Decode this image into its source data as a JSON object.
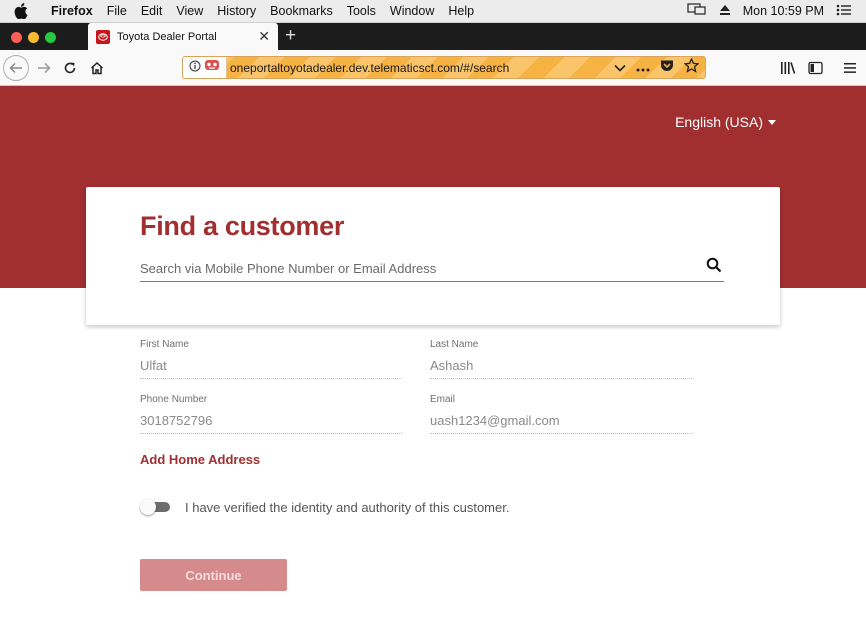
{
  "menubar": {
    "app_name": "Firefox",
    "items": [
      "File",
      "Edit",
      "View",
      "History",
      "Bookmarks",
      "Tools",
      "Window",
      "Help"
    ],
    "clock": "Mon 10:59 PM"
  },
  "browser": {
    "tab_title": "Toyota Dealer Portal",
    "url": "oneportaltoyotadealer.dev.telematicsct.com/#/search"
  },
  "page": {
    "language": "English (USA)",
    "card_title": "Find a customer",
    "search_placeholder": "Search via Mobile Phone Number or Email Address",
    "fields": {
      "first_name": {
        "label": "First Name",
        "value": "Ulfat"
      },
      "last_name": {
        "label": "Last Name",
        "value": "Ashash"
      },
      "phone": {
        "label": "Phone Number",
        "value": "3018752796"
      },
      "email": {
        "label": "Email",
        "value": "uash1234@gmail.com"
      }
    },
    "add_address_label": "Add Home Address",
    "verify_text": "I have verified the identity and authority of this customer.",
    "verify_checked": false,
    "continue_label": "Continue"
  },
  "colors": {
    "brand_red": "#a12f30",
    "button_disabled": "#d58a8c",
    "url_bar_orange": "#f7b244"
  },
  "icons": [
    "apple-icon",
    "screen-mirror-icon",
    "eject-icon",
    "notification-list-icon",
    "toyota-favicon",
    "close-icon",
    "plus-icon",
    "back-arrow-icon",
    "forward-arrow-icon",
    "reload-icon",
    "home-icon",
    "info-icon",
    "robot-mask-icon",
    "chevron-down-icon",
    "more-dots-icon",
    "pocket-icon",
    "star-icon",
    "library-icon",
    "sidebar-icon",
    "hamburger-menu-icon",
    "search-icon"
  ]
}
